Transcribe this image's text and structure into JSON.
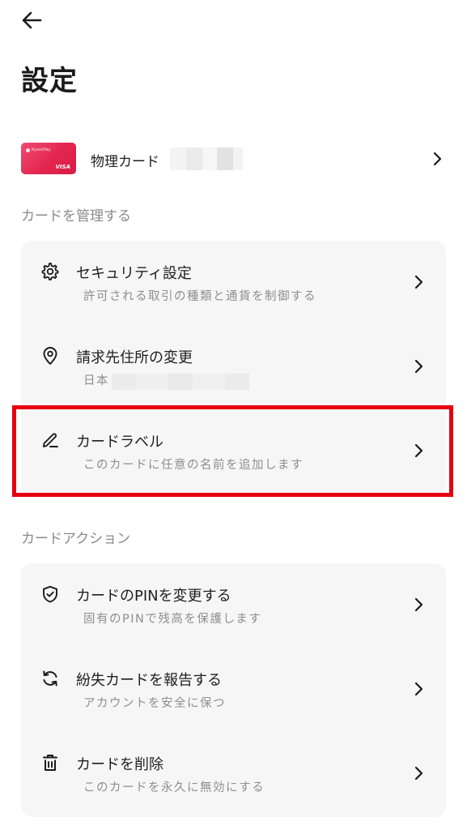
{
  "header": {
    "title": "設定"
  },
  "card": {
    "name": "物理カード",
    "brand_mark": "VISA",
    "brand_small": "KyashPay",
    "color": "#e3264f"
  },
  "sections": [
    {
      "header": "カードを管理する",
      "items": [
        {
          "icon": "gear-icon",
          "title": "セキュリティ設定",
          "subtitle": "許可される取引の種類と通貨を制御する"
        },
        {
          "icon": "location-pin-icon",
          "title": "請求先住所の変更",
          "subtitle": "日本"
        },
        {
          "icon": "pencil-icon",
          "title": "カードラベル",
          "subtitle": "このカードに任意の名前を追加します",
          "highlighted": true
        }
      ]
    },
    {
      "header": "カードアクション",
      "items": [
        {
          "icon": "shield-check-icon",
          "title": "カードのPINを変更する",
          "subtitle": "固有のPINで残高を保護します"
        },
        {
          "icon": "refresh-icon",
          "title": "紛失カードを報告する",
          "subtitle": "アカウントを安全に保つ"
        },
        {
          "icon": "trash-icon",
          "title": "カードを削除",
          "subtitle": "このカードを永久に無効にする"
        }
      ]
    }
  ],
  "colors": {
    "highlight": "#e60012",
    "panel": "#f6f6f6",
    "muted": "#8e8e8e"
  }
}
